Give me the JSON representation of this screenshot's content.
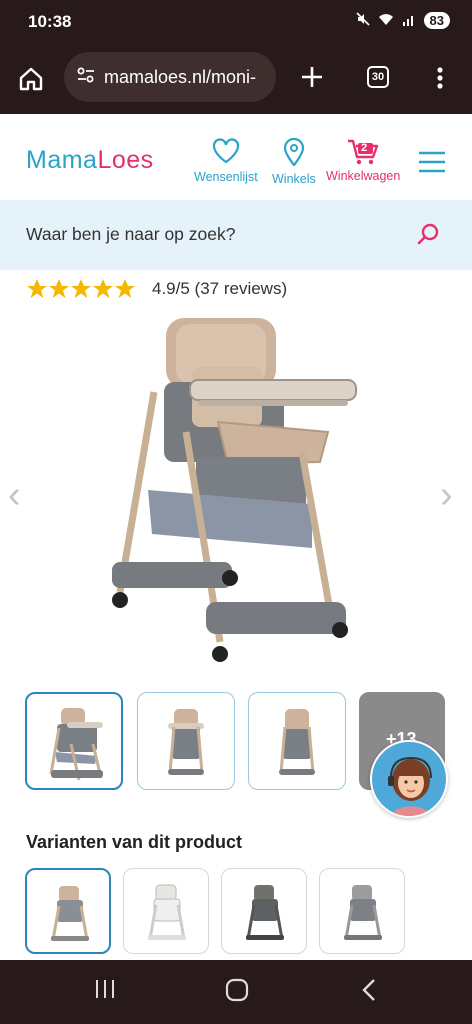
{
  "status_bar": {
    "time": "10:38",
    "battery": "83"
  },
  "browser": {
    "url": "mamaloes.nl/moni-",
    "tab_count": "30"
  },
  "header": {
    "logo_part1": "Mama",
    "logo_part2": "Loes",
    "wishlist_label": "Wensenlijst",
    "stores_label": "Winkels",
    "cart_label": "Winkelwagen",
    "cart_count": "2",
    "colors": {
      "primary": "#2aa2c9",
      "accent": "#e5306b"
    }
  },
  "search": {
    "placeholder": "Waar ben je naar op zoek?"
  },
  "rating": {
    "stars": 5,
    "text": "4.9/5 (37 reviews)"
  },
  "gallery": {
    "more_label": "+13"
  },
  "variants": {
    "title": "Varianten van dit product"
  }
}
